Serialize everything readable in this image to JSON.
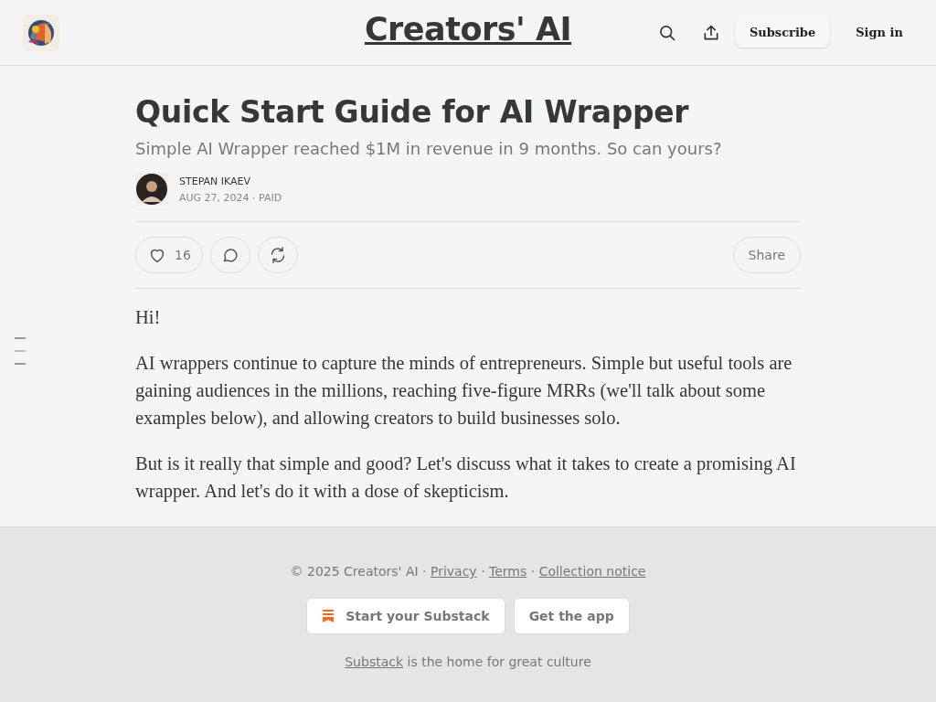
{
  "header": {
    "title": "Creators' AI",
    "buttons": [
      {
        "label": "Subscribe",
        "kind": "outlined"
      },
      {
        "label": "Sign in",
        "kind": "plain"
      }
    ]
  },
  "post": {
    "title": "Quick Start Guide for AI Wrapper",
    "subtitle": "Simple AI Wrapper reached $1M in revenue in 9 months. So can yours?",
    "author": "STEPAN IKAEV",
    "date": "AUG 27, 2024",
    "separator": "·",
    "access": "PAID",
    "actions": [
      {
        "kind": "like",
        "count": "16"
      },
      {
        "kind": "comment"
      },
      {
        "kind": "restack"
      }
    ],
    "share": "Share",
    "paragraphs": [
      "Hi!",
      "AI wrappers continue to capture the minds of entrepreneurs. Simple but useful tools are gaining audiences in the millions, reaching five-figure MRRs (we'll talk about some examples below), and allowing creators to build businesses solo.",
      "But is it really that simple and good? Let's discuss what it takes to create a promising AI wrapper. And let's do it with a dose of skepticism."
    ]
  },
  "footer": {
    "copyright": "© 2025 Creators' AI",
    "separator": "·",
    "links": [
      "Privacy",
      "Terms",
      "Collection notice"
    ],
    "buttons": [
      {
        "label": "Start your Substack",
        "kind": "brand"
      },
      {
        "label": "Get the app",
        "kind": "plain"
      }
    ],
    "tagline_link": "Substack",
    "tagline": "is the home for great culture"
  }
}
